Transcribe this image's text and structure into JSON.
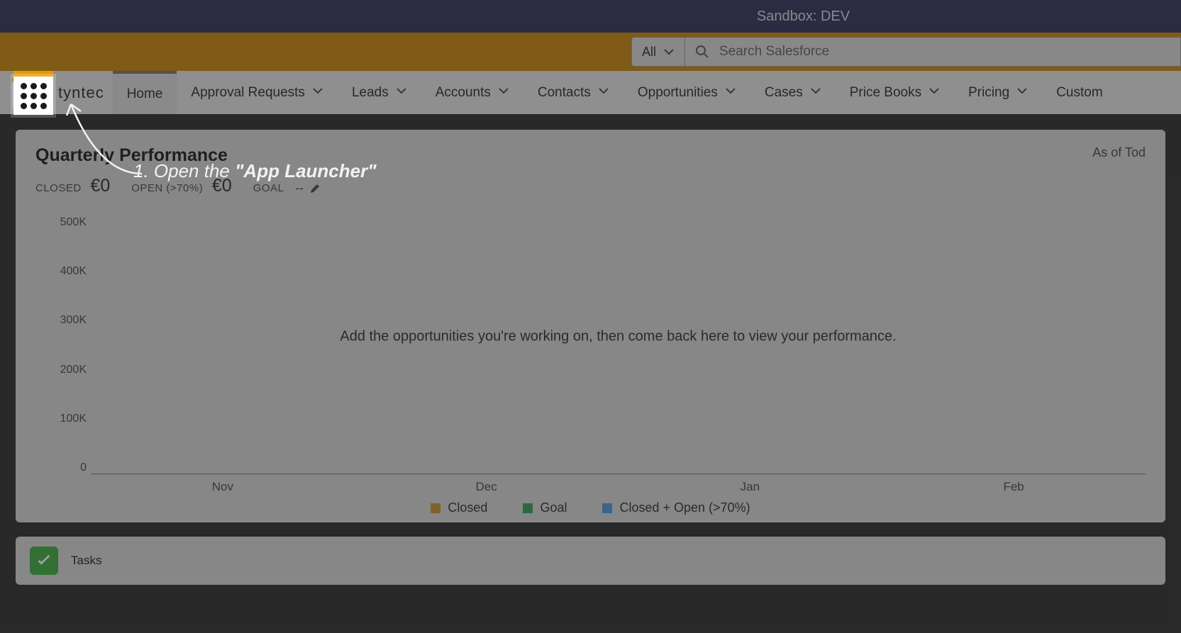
{
  "sandbox_label": "Sandbox: DEV",
  "search": {
    "scope": "All",
    "placeholder": "Search Salesforce"
  },
  "brand": "tyntec",
  "nav": {
    "active": "Home",
    "tabs": [
      "Home",
      "Approval Requests",
      "Leads",
      "Accounts",
      "Contacts",
      "Opportunities",
      "Cases",
      "Price Books",
      "Pricing",
      "Custom"
    ]
  },
  "perf": {
    "title": "Quarterly Performance",
    "as_of": "As of Tod",
    "closed_label": "CLOSED",
    "closed_value": "€0",
    "open_label": "OPEN (>70%)",
    "open_value": "€0",
    "goal_label": "GOAL",
    "goal_value": "--",
    "empty_msg": "Add the opportunities you're working on, then come back here to view your performance."
  },
  "chart_data": {
    "type": "bar",
    "categories": [
      "Nov",
      "Dec",
      "Jan",
      "Feb"
    ],
    "series": [
      {
        "name": "Closed",
        "values": [
          0,
          0,
          0,
          0
        ],
        "color": "#c79a3b"
      },
      {
        "name": "Goal",
        "values": [
          0,
          0,
          0,
          0
        ],
        "color": "#3fa46a"
      },
      {
        "name": "Closed + Open (>70%)",
        "values": [
          0,
          0,
          0,
          0
        ],
        "color": "#5b9bd5"
      }
    ],
    "title": "Quarterly Performance",
    "xlabel": "",
    "ylabel": "",
    "y_ticks": [
      "500K",
      "400K",
      "300K",
      "200K",
      "100K",
      "0"
    ],
    "ylim": [
      0,
      500000
    ]
  },
  "tasks": {
    "title": "Tasks"
  },
  "annotation": {
    "step_prefix": "1. Open the ",
    "step_highlight": "\"App Launcher\""
  },
  "colors": {
    "brandOrange": "#c78d1e",
    "legendClosed": "#c79a3b",
    "legendGoal": "#3fa46a",
    "legendOpen": "#5b9bd5"
  }
}
